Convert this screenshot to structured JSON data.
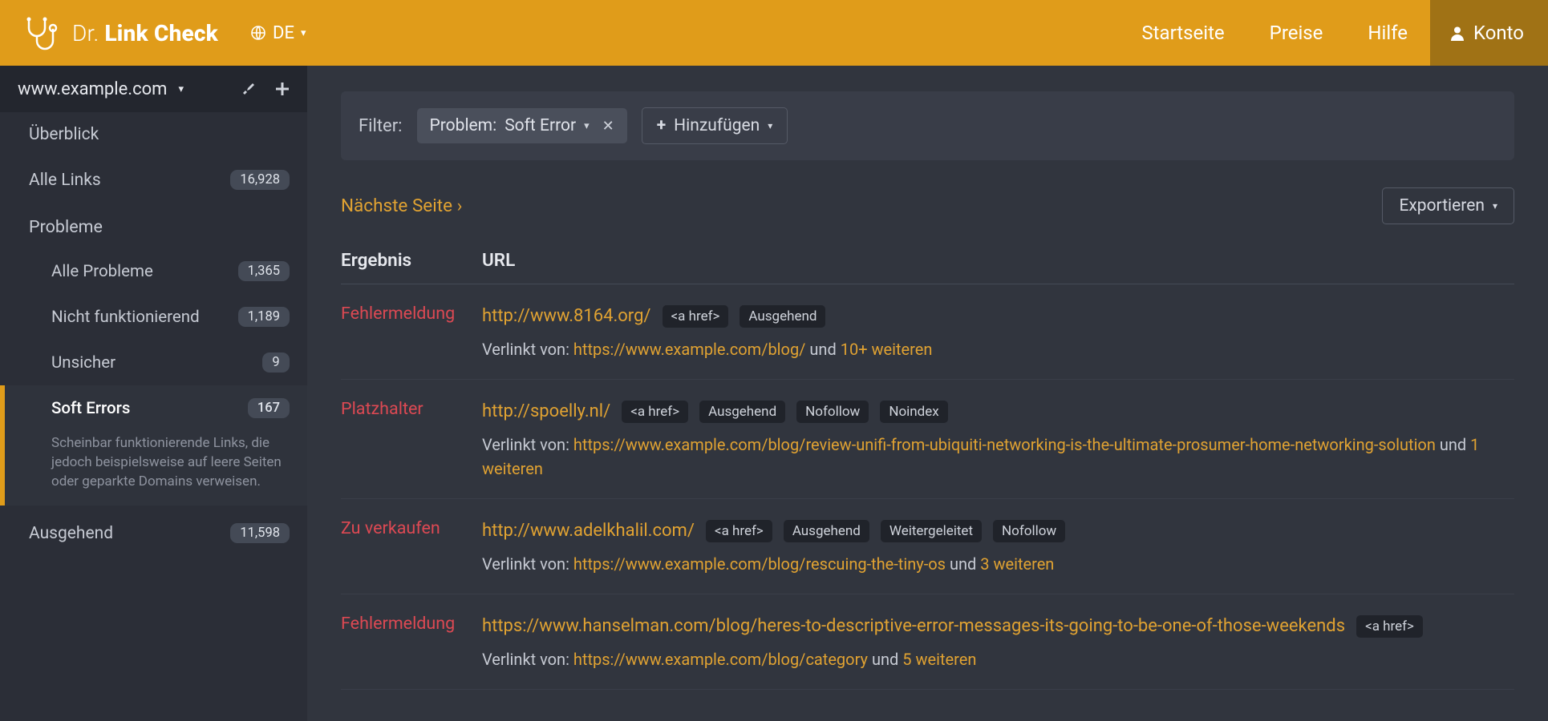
{
  "header": {
    "brand_prefix": "Dr.",
    "brand_bold": "Link Check",
    "lang_label": "DE",
    "nav": {
      "home": "Startseite",
      "pricing": "Preise",
      "help": "Hilfe",
      "account": "Konto"
    }
  },
  "sidebar": {
    "site": "www.example.com",
    "overview": "Überblick",
    "all_links": {
      "label": "Alle Links",
      "count": "16,928"
    },
    "problems_section": "Probleme",
    "problems": {
      "all": {
        "label": "Alle Probleme",
        "count": "1,365"
      },
      "broken": {
        "label": "Nicht funktionierend",
        "count": "1,189"
      },
      "unsafe": {
        "label": "Unsicher",
        "count": "9"
      },
      "soft": {
        "label": "Soft Errors",
        "count": "167",
        "desc": "Scheinbar funktionierende Links, die jedoch beispielsweise auf leere Seiten oder geparkte Domains verweisen."
      }
    },
    "outgoing": {
      "label": "Ausgehend",
      "count": "11,598"
    }
  },
  "filter": {
    "label": "Filter:",
    "chip_key": "Problem:",
    "chip_value": "Soft Error",
    "add": "Hinzufügen"
  },
  "pager": {
    "next": "Nächste Seite ›"
  },
  "export_label": "Exportieren",
  "columns": {
    "result": "Ergebnis",
    "url": "URL"
  },
  "linked_from_label": "Verlinkt von:",
  "and_word": "und",
  "rows": [
    {
      "type": "Fehlermeldung",
      "url": "http://www.8164.org/",
      "tags": [
        "<a href>",
        "Ausgehend"
      ],
      "from": "https://www.example.com/blog/",
      "more": "10+ weiteren"
    },
    {
      "type": "Platzhalter",
      "url": "http://spoelly.nl/",
      "tags": [
        "<a href>",
        "Ausgehend",
        "Nofollow",
        "Noindex"
      ],
      "from": "https://www.example.com/blog/review-unifi-from-ubiquiti-networking-is-the-ultimate-prosumer-home-networking-solution",
      "more": "1 weiteren"
    },
    {
      "type": "Zu verkaufen",
      "url": "http://www.adelkhalil.com/",
      "tags": [
        "<a href>",
        "Ausgehend",
        "Weitergeleitet",
        "Nofollow"
      ],
      "from": "https://www.example.com/blog/rescuing-the-tiny-os",
      "more": "3 weiteren"
    },
    {
      "type": "Fehlermeldung",
      "url": "https://www.hanselman.com/blog/heres-to-descriptive-error-messages-its-going-to-be-one-of-those-weekends",
      "tags": [
        "<a href>"
      ],
      "from": "https://www.example.com/blog/category",
      "more": "5 weiteren"
    }
  ]
}
